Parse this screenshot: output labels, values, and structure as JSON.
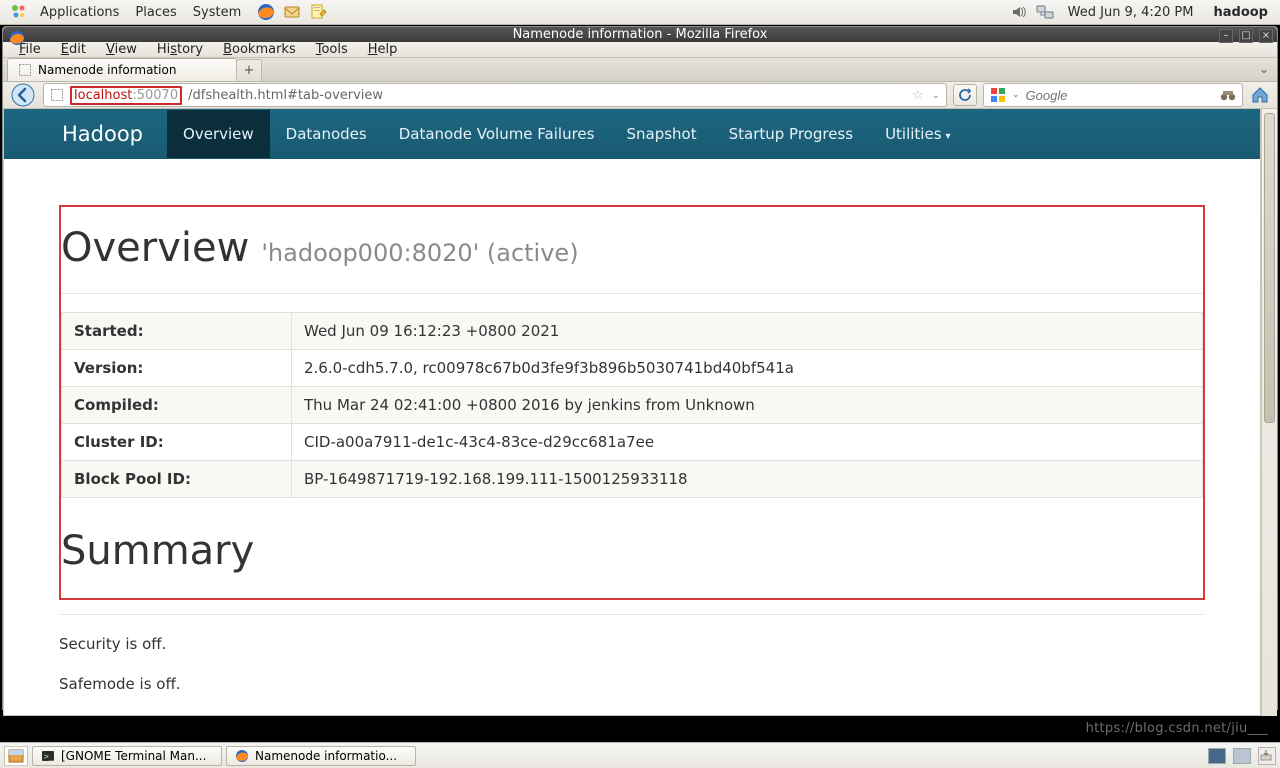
{
  "gnome_panel": {
    "menus": [
      "Applications",
      "Places",
      "System"
    ],
    "clock": "Wed Jun  9,  4:20 PM",
    "user": "hadoop"
  },
  "firefox": {
    "window_title": "Namenode information - Mozilla Firefox",
    "menubar": [
      "File",
      "Edit",
      "View",
      "History",
      "Bookmarks",
      "Tools",
      "Help"
    ],
    "tab_title": "Namenode information",
    "url_host": "localhost",
    "url_port": ":50070",
    "url_path": "/dfshealth.html#tab-overview",
    "search_placeholder": "Google"
  },
  "namenode": {
    "brand": "Hadoop",
    "nav": [
      "Overview",
      "Datanodes",
      "Datanode Volume Failures",
      "Snapshot",
      "Startup Progress",
      "Utilities"
    ],
    "overview_title": "Overview",
    "overview_sub": "'hadoop000:8020' (active)",
    "rows": [
      {
        "k": "Started:",
        "v": "Wed Jun 09 16:12:23 +0800 2021"
      },
      {
        "k": "Version:",
        "v": "2.6.0-cdh5.7.0, rc00978c67b0d3fe9f3b896b5030741bd40bf541a"
      },
      {
        "k": "Compiled:",
        "v": "Thu Mar 24 02:41:00 +0800 2016 by jenkins from Unknown"
      },
      {
        "k": "Cluster ID:",
        "v": "CID-a00a7911-de1c-43c4-83ce-d29cc681a7ee"
      },
      {
        "k": "Block Pool ID:",
        "v": "BP-1649871719-192.168.199.111-1500125933118"
      }
    ],
    "summary_title": "Summary",
    "security_line": "Security is off.",
    "safemode_line": "Safemode is off."
  },
  "taskbar": {
    "items": [
      "[GNOME Terminal Man...",
      "Namenode informatio..."
    ]
  },
  "watermark": "https://blog.csdn.net/jiu___"
}
